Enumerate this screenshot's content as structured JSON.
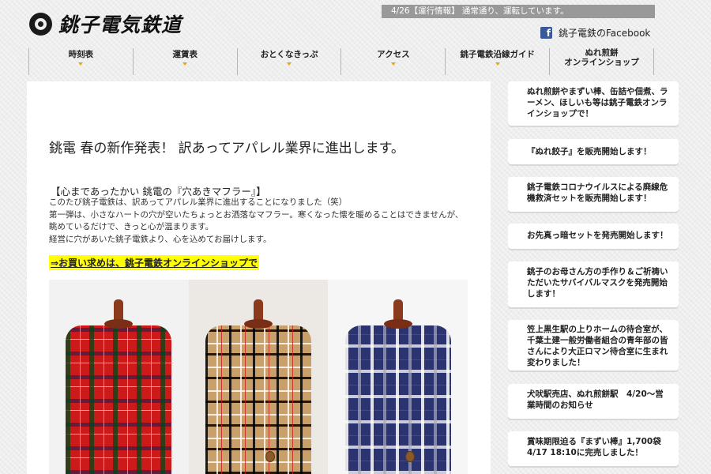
{
  "header": {
    "logo_text": "銚子電気鉄道",
    "ticker": "4/26【運行情報】 通常通り、運転しています。",
    "facebook_label": "銚子電鉄のFacebook",
    "facebook_icon_glyph": "f"
  },
  "nav": [
    {
      "label": "時刻表"
    },
    {
      "label": "運賃表"
    },
    {
      "label": "おとくなきっぷ"
    },
    {
      "label": "アクセス"
    },
    {
      "label": "銚子電鉄沿線ガイド"
    },
    {
      "line1": "ぬれ煎餅",
      "line2": "オンラインショップ"
    }
  ],
  "article": {
    "title": "銚電 春の新作発表！ 訳あってアパレル業界に進出します。",
    "subhead": "【心まであったかい 銚電の『穴あきマフラー』】",
    "body": [
      "このたび銚子電鉄は、訳あってアパレル業界に進出することになりました（笑）",
      "第一弾は、小さなハートの穴が空いたちょっとお洒落なマフラー。寒くなった懐を暖めることはできませんが、",
      "眺めているだけで、きっと心が温まります。",
      "経営に穴があいた銚子電鉄より、心を込めてお届けします。"
    ],
    "shop_link": "⇒お買い求めは、銚子電鉄オンラインショップで",
    "photo_colors": {
      "red": "#cc1a1a",
      "camel": "#c9a06a",
      "navy": "#2b3470"
    }
  },
  "sidebar": [
    {
      "lines": [
        "ぬれ煎餅やまずい棒、缶詰や佃煮、ラ",
        "ーメン、ほしいも等は銚子電鉄オンラ",
        "インショップで！"
      ]
    },
    {
      "lines": [
        "『ぬれ餃子』を販売開始します！"
      ]
    },
    {
      "lines": [
        "銚子電鉄コロナウイルスによる廃線危",
        "機救済セットを販売開始します！"
      ]
    },
    {
      "lines": [
        "お先真っ暗セットを発売開始します！"
      ]
    },
    {
      "lines": [
        "銚子のお母さん方の手作り＆ご祈祷い",
        "ただいたサバイバルマスクを発売開始",
        "します！"
      ]
    },
    {
      "lines": [
        "笠上黒生駅の上りホームの待合室が、",
        "千葉土建一般労働者組合の青年部の皆",
        "さんにより大正ロマン待合室に生まれ",
        "変わりました！"
      ]
    },
    {
      "lines": [
        "犬吠駅売店、ぬれ煎餅駅　4/20〜営",
        "業時間のお知らせ"
      ]
    },
    {
      "lines": [
        "賞味期限迫る『まずい棒』1,700袋",
        "4/17 18:10に完売しました！"
      ]
    }
  ],
  "colors": {
    "ticker_bg": "#999999",
    "nav_caret": "#e3a812",
    "highlight": "#ffff00",
    "facebook": "#3b5998"
  }
}
